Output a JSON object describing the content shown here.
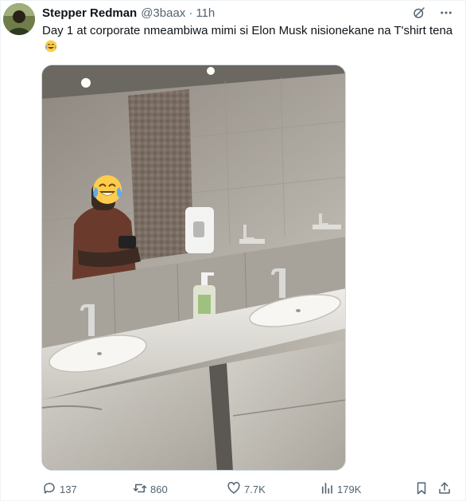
{
  "tweet": {
    "display_name": "Stepper Redman",
    "handle": "@3baax",
    "separator": "·",
    "time": "11h",
    "text": "Day 1 at corporate nmeambiwa mimi si Elon Musk nisionekane na T'shirt tena",
    "emoji": "tears-of-joy-emoji"
  },
  "icons": {
    "grok": "grok-icon",
    "more": "more-icon",
    "reply": "reply-icon",
    "retweet": "retweet-icon",
    "like": "like-icon",
    "views": "views-icon",
    "bookmark": "bookmark-icon",
    "share": "share-icon"
  },
  "media": {
    "subject": "mirror-selfie-bathroom",
    "face_emoji": "tears-of-joy-emoji"
  },
  "actions": {
    "replies": "137",
    "retweets": "860",
    "likes": "7.7K",
    "views": "179K"
  },
  "colors": {
    "text": "#0f1419",
    "secondary": "#536471",
    "border": "#cfd9de"
  }
}
